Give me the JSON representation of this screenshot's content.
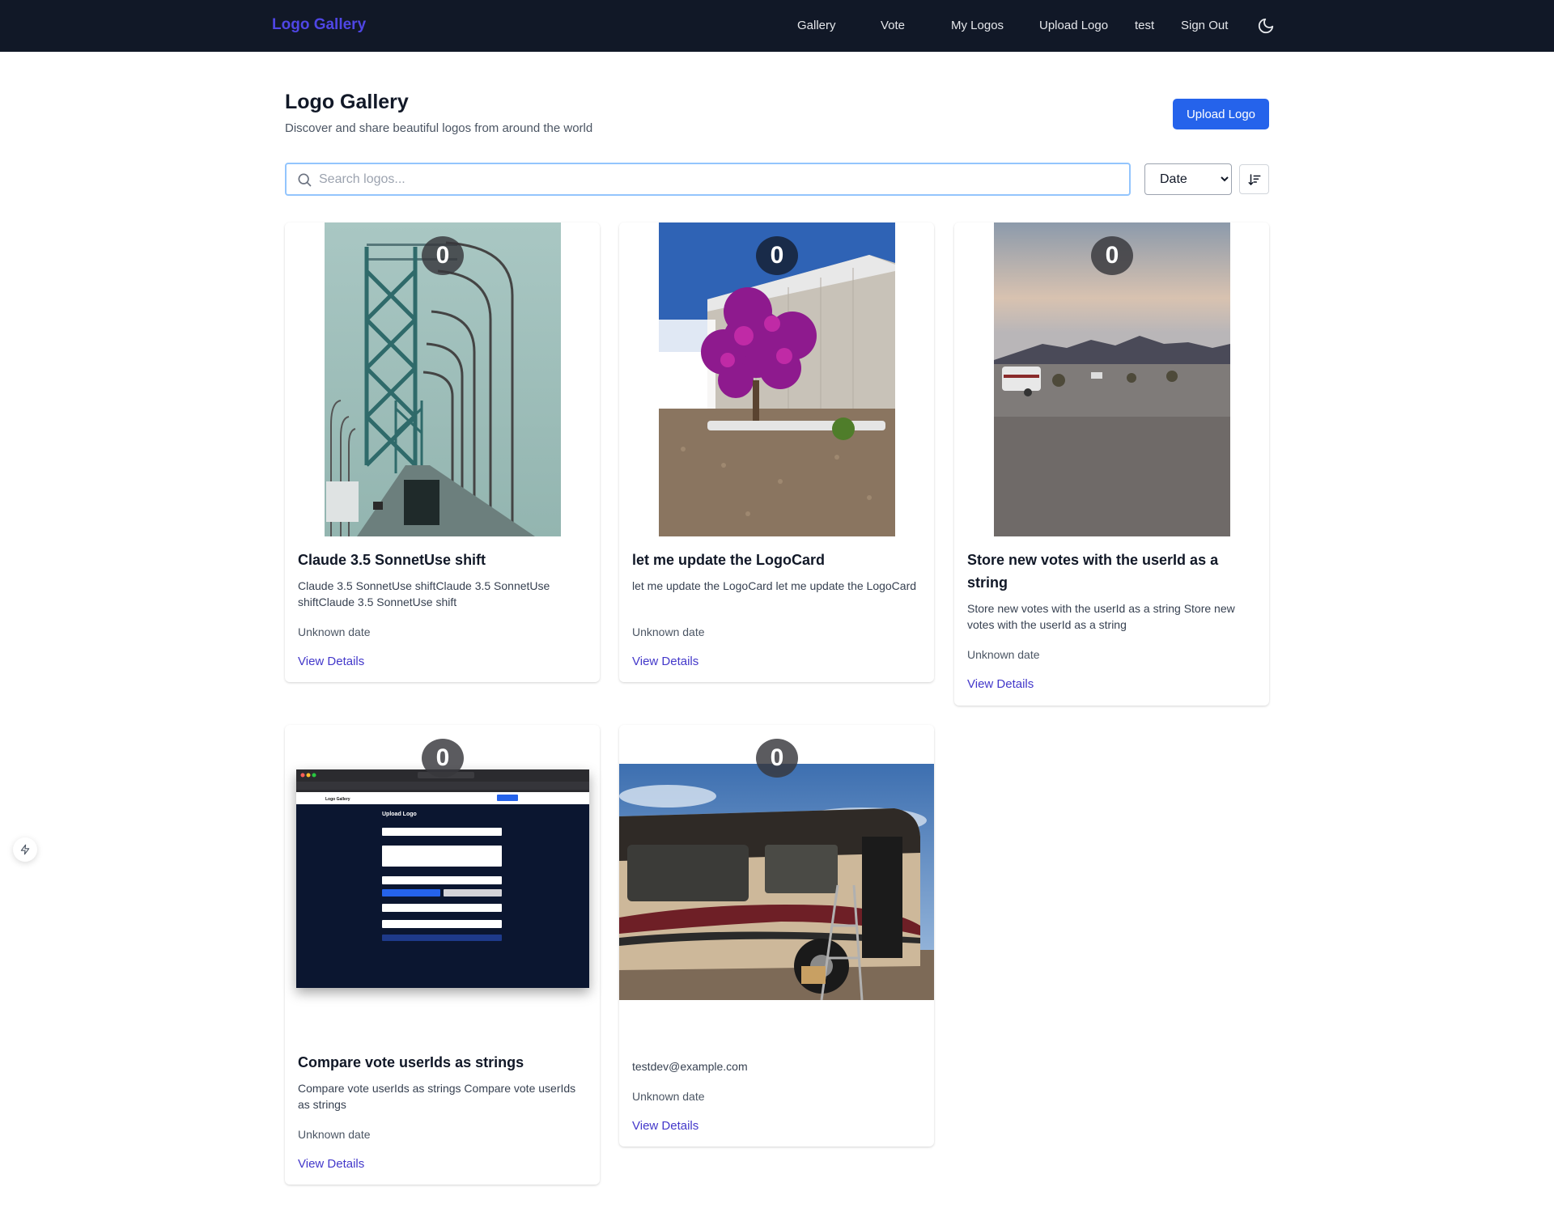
{
  "nav": {
    "brand": "Logo Gallery",
    "links": [
      "Gallery",
      "Vote",
      "My Logos",
      "Upload Logo",
      "test",
      "Sign Out"
    ],
    "theme_icon": "moon-icon"
  },
  "header": {
    "title": "Logo Gallery",
    "subtitle": "Discover and share beautiful logos from around the world",
    "upload_label": "Upload Logo"
  },
  "search": {
    "placeholder": "Search logos...",
    "value": "",
    "sort_value": "Date",
    "sort_options": [
      "Date"
    ],
    "sort_icon": "sort-descending-icon"
  },
  "cards": [
    {
      "votes": "0",
      "title": "Claude 3.5 SonnetUse shift",
      "description": "Claude 3.5 SonnetUse shiftClaude 3.5 SonnetUse shiftClaude 3.5 SonnetUse shift",
      "date": "Unknown date",
      "link": "View Details",
      "image": "bridge-photo"
    },
    {
      "votes": "0",
      "title": "let me update the LogoCard",
      "description": "let me update the LogoCard let me update the LogoCard",
      "date": "Unknown date",
      "link": "View Details",
      "image": "bougainvillea-photo"
    },
    {
      "votes": "0",
      "title": "Store new votes with the userId as a string",
      "description": "Store new votes with the userId as a string Store new votes with the userId as a string",
      "date": "Unknown date",
      "link": "View Details",
      "image": "desert-campsite-photo"
    },
    {
      "votes": "0",
      "title": "Compare vote userIds as strings",
      "description": "Compare vote userIds as strings Compare vote userIds as strings",
      "date": "Unknown date",
      "link": "View Details",
      "image": "upload-form-screenshot",
      "screenshot_title": "Upload Logo",
      "screenshot_brand": "Logo Gallery"
    },
    {
      "votes": "0",
      "author": "testdev@example.com",
      "date": "Unknown date",
      "link": "View Details",
      "image": "motorhome-photo"
    }
  ],
  "widget": {
    "icon": "lightning-icon"
  },
  "colors": {
    "navbar": "#111827",
    "accent": "#4f46e5",
    "primary": "#2563eb",
    "link": "#4338ca"
  }
}
